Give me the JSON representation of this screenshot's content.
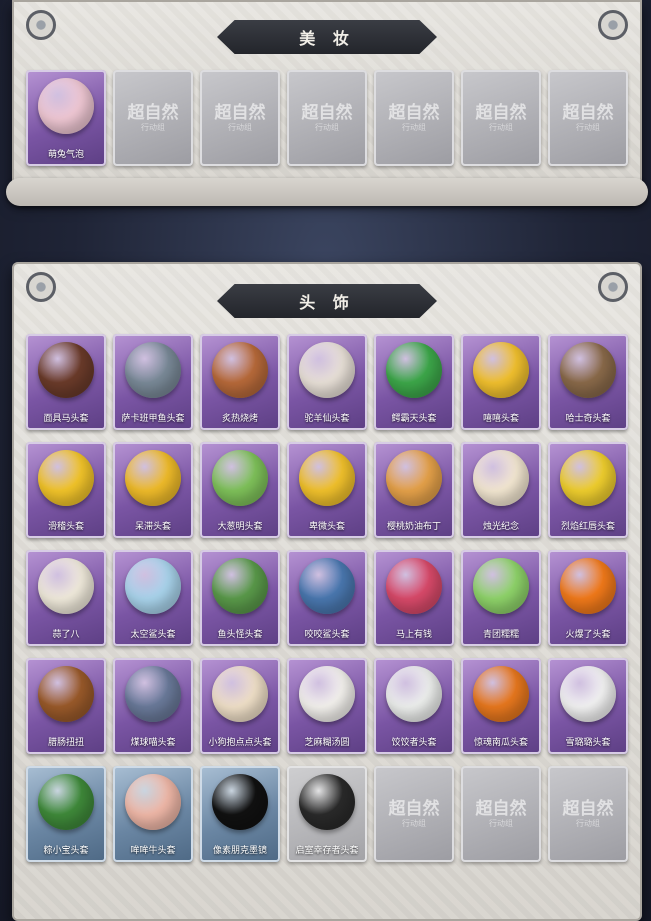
{
  "makeup": {
    "title": "美 妆",
    "items": [
      {
        "label": "萌兔气泡",
        "icon": "bunny-bubble-icon",
        "color": "#f0c8d4",
        "tile": "purple"
      },
      {
        "label": "",
        "tile": "empty"
      },
      {
        "label": "",
        "tile": "empty"
      },
      {
        "label": "",
        "tile": "empty"
      },
      {
        "label": "",
        "tile": "empty"
      },
      {
        "label": "",
        "tile": "empty"
      },
      {
        "label": "",
        "tile": "empty"
      }
    ]
  },
  "headwear": {
    "title": "头 饰",
    "items": [
      {
        "label": "面具马头套",
        "icon": "horse-head-icon",
        "color": "#6b3b2a",
        "tile": "purple"
      },
      {
        "label": "萨卡班甲鱼头套",
        "icon": "fish-head-icon",
        "color": "#7a8a98",
        "tile": "purple"
      },
      {
        "label": "炙热烧烤",
        "icon": "bbq-meat-icon",
        "color": "#b86a3a",
        "tile": "purple"
      },
      {
        "label": "驼羊仙头套",
        "icon": "alpaca-head-icon",
        "color": "#e9e1d8",
        "tile": "purple"
      },
      {
        "label": "鳄霸天头套",
        "icon": "crocodile-head-icon",
        "color": "#3da84a",
        "tile": "purple"
      },
      {
        "label": "嘻嘻头套",
        "icon": "grin-emoji-icon",
        "color": "#f2c12e",
        "tile": "purple"
      },
      {
        "label": "哈士奇头套",
        "icon": "husky-head-icon",
        "color": "#8a6a4a",
        "tile": "purple"
      },
      {
        "label": "滑稽头套",
        "icon": "smirk-emoji-icon",
        "color": "#f3c52a",
        "tile": "purple"
      },
      {
        "label": "呆滞头套",
        "icon": "dazed-emoji-icon",
        "color": "#f0bc2a",
        "tile": "purple"
      },
      {
        "label": "大葱明头套",
        "icon": "scallion-head-icon",
        "color": "#7fc25a",
        "tile": "purple"
      },
      {
        "label": "卑微头套",
        "icon": "humble-emoji-icon",
        "color": "#f2c22c",
        "tile": "purple"
      },
      {
        "label": "樱桃奶油布丁",
        "icon": "pudding-icon",
        "color": "#e6a24a",
        "tile": "purple"
      },
      {
        "label": "烛光纪念",
        "icon": "candle-icon",
        "color": "#f4e8d2",
        "tile": "purple"
      },
      {
        "label": "烈焰红唇头套",
        "icon": "pikachu-head-icon",
        "color": "#f0cf2e",
        "tile": "purple"
      },
      {
        "label": "蒜了八",
        "icon": "garlic-head-icon",
        "color": "#f1ebdc",
        "tile": "purple"
      },
      {
        "label": "太空鲨头套",
        "icon": "space-shark-icon",
        "color": "#a9d4ec",
        "tile": "purple"
      },
      {
        "label": "鱼头怪头套",
        "icon": "fish-monster-icon",
        "color": "#5a9a4a",
        "tile": "purple"
      },
      {
        "label": "咬咬鲨头套",
        "icon": "shark-head-icon",
        "color": "#4a78b0",
        "tile": "purple"
      },
      {
        "label": "马上有钱",
        "icon": "pink-horse-icon",
        "color": "#d94a6a",
        "tile": "purple"
      },
      {
        "label": "青团糯糯",
        "icon": "green-dumpling-icon",
        "color": "#8fd46a",
        "tile": "purple"
      },
      {
        "label": "火爆了头套",
        "icon": "fire-head-icon",
        "color": "#f27a1a",
        "tile": "purple"
      },
      {
        "label": "腊肠扭扭",
        "icon": "sausage-dog-icon",
        "color": "#9a5a2a",
        "tile": "purple"
      },
      {
        "label": "煤球喵头套",
        "icon": "gray-cat-icon",
        "color": "#6a7a9a",
        "tile": "purple"
      },
      {
        "label": "小狗抱点点头套",
        "icon": "puppy-head-icon",
        "color": "#f0e0c8",
        "tile": "purple"
      },
      {
        "label": "芝麻糊汤圆",
        "icon": "rice-ball-icon",
        "color": "#f4f2ee",
        "tile": "purple"
      },
      {
        "label": "饺饺者头套",
        "icon": "dumpling-head-icon",
        "color": "#eef0ee",
        "tile": "purple"
      },
      {
        "label": "惊魂南瓜头套",
        "icon": "pumpkin-head-icon",
        "color": "#e8781e",
        "tile": "purple"
      },
      {
        "label": "雪璐璐头套",
        "icon": "snowman-head-icon",
        "color": "#f3f3f3",
        "tile": "purple"
      },
      {
        "label": "粽小宝头套",
        "icon": "zongzi-head-icon",
        "color": "#3f8a3a",
        "tile": "blue"
      },
      {
        "label": "哞哞牛头套",
        "icon": "cow-head-icon",
        "color": "#f0b8a8",
        "tile": "blue"
      },
      {
        "label": "像素朋克墨镜",
        "icon": "pixel-sunglasses-icon",
        "color": "#111111",
        "tile": "blue"
      },
      {
        "label": "启室幸存者头套",
        "icon": "gas-mask-icon",
        "color": "#2a2a2a",
        "tile": "gray"
      },
      {
        "label": "",
        "tile": "empty"
      },
      {
        "label": "",
        "tile": "empty"
      },
      {
        "label": "",
        "tile": "empty"
      }
    ]
  },
  "placeholder": {
    "watermark": "超自然",
    "watermark_sub": "行动组"
  }
}
